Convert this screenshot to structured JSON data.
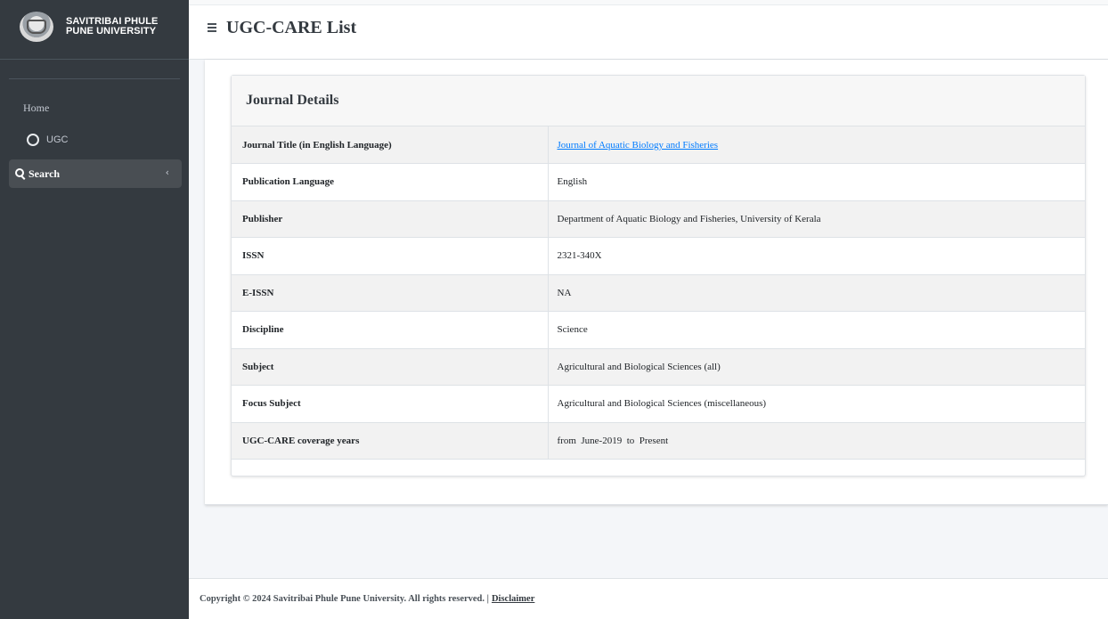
{
  "brand": {
    "line1": "SAVITRIBAI PHULE",
    "line2": "PUNE UNIVERSITY"
  },
  "sidebar": {
    "home_label": "Home",
    "ugc_label": "UGC",
    "search_label": "Search",
    "chevron": "‹"
  },
  "header": {
    "title": "UGC-CARE List"
  },
  "card": {
    "title": "Journal Details",
    "rows": [
      {
        "label": "Journal Title (in English Language)",
        "value": "Journal of Aquatic Biology and Fisheries"
      },
      {
        "label": "Publication Language",
        "value": "English"
      },
      {
        "label": "Publisher",
        "value": "Department of Aquatic Biology and Fisheries, University of Kerala"
      },
      {
        "label": "ISSN",
        "value": "2321-340X"
      },
      {
        "label": "E-ISSN",
        "value": "NA"
      },
      {
        "label": "Discipline",
        "value": "Science"
      },
      {
        "label": "Subject",
        "value": "Agricultural and Biological Sciences (all)"
      },
      {
        "label": "Focus Subject",
        "value": "Agricultural and Biological Sciences (miscellaneous)"
      },
      {
        "label": "UGC-CARE coverage years",
        "value": "from  June-2019  to  Present"
      }
    ]
  },
  "footer": {
    "copyright": "Copyright © 2024 Savitribai Phule Pune University. All rights reserved. |",
    "disclaimer": "Disclaimer"
  },
  "colors": {
    "sidebar_bg": "#343a40",
    "link": "#007bff",
    "active_item_bg": "#494e53"
  }
}
